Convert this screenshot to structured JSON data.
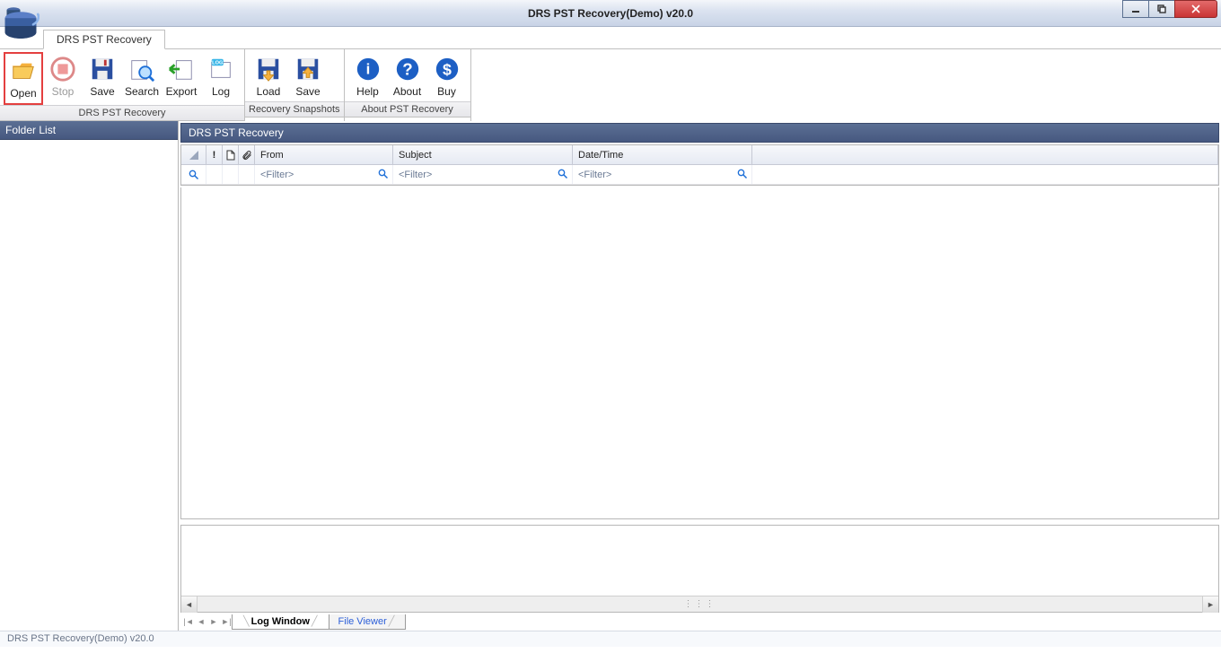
{
  "window": {
    "title": "DRS PST Recovery(Demo) v20.0"
  },
  "main_tab": "DRS PST Recovery",
  "ribbon": {
    "groups": [
      {
        "label": "DRS PST Recovery",
        "buttons": [
          {
            "id": "open",
            "label": "Open",
            "disabled": false,
            "highlight": true
          },
          {
            "id": "stop",
            "label": "Stop",
            "disabled": true
          },
          {
            "id": "save",
            "label": "Save",
            "disabled": false
          },
          {
            "id": "search",
            "label": "Search",
            "disabled": false
          },
          {
            "id": "export",
            "label": "Export",
            "disabled": false
          },
          {
            "id": "log",
            "label": "Log",
            "disabled": false
          }
        ]
      },
      {
        "label": "Recovery Snapshots",
        "buttons": [
          {
            "id": "snap-load",
            "label": "Load",
            "disabled": false
          },
          {
            "id": "snap-save",
            "label": "Save",
            "disabled": false
          }
        ]
      },
      {
        "label": "About PST Recovery",
        "buttons": [
          {
            "id": "help",
            "label": "Help",
            "disabled": false
          },
          {
            "id": "about",
            "label": "About",
            "disabled": false
          },
          {
            "id": "buy",
            "label": "Buy",
            "disabled": false
          }
        ]
      }
    ]
  },
  "sidebar": {
    "title": "Folder List"
  },
  "content_pane": {
    "title": "DRS PST Recovery"
  },
  "grid": {
    "columns": {
      "from": "From",
      "subject": "Subject",
      "date": "Date/Time"
    },
    "filter_placeholder": "<Filter>"
  },
  "bottom_tabs": {
    "active": "Log Window",
    "inactive": "File Viewer"
  },
  "statusbar": "DRS PST Recovery(Demo) v20.0"
}
